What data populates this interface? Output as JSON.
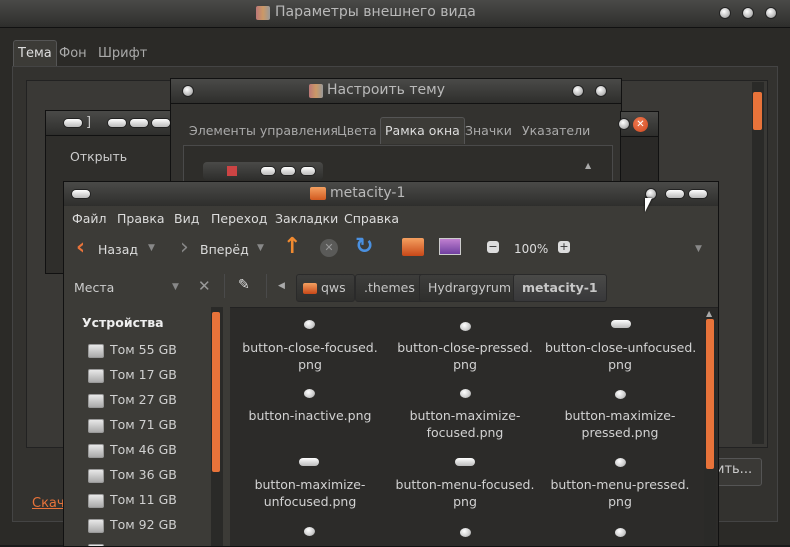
{
  "appearance_window": {
    "title": "Параметры внешнего вида",
    "tabs": [
      "Тема",
      "Фон",
      "Шрифт"
    ],
    "download_link": "Скача",
    "bottom_button": "ить..."
  },
  "mini_window": {
    "title": "]",
    "open_button": "Открыть"
  },
  "theme_window": {
    "title": "Настроить тему",
    "tabs": [
      "Элементы управления",
      "Цвета",
      "Рамка окна",
      "Значки",
      "Указатели"
    ]
  },
  "file_manager": {
    "title": "metacity-1",
    "menu": [
      "Файл",
      "Правка",
      "Вид",
      "Переход",
      "Закладки",
      "Справка"
    ],
    "toolbar": {
      "back": "Назад",
      "forward": "Вперёд",
      "zoom": "100%"
    },
    "places_label": "Места",
    "breadcrumbs": [
      "qws",
      ".themes",
      "Hydrargyrum",
      "metacity-1"
    ],
    "sidebar": {
      "header": "Устройства",
      "devices": [
        "Том 55 GB",
        "Том 17 GB",
        "Том 27 GB",
        "Том 71 GB",
        "Том 46 GB",
        "Том 36 GB",
        "Том 11 GB",
        "Том 92 GB"
      ]
    },
    "files": [
      {
        "name": "button-close-focused.\npng",
        "icon": "round"
      },
      {
        "name": "button-close-pressed.\npng",
        "icon": "round"
      },
      {
        "name": "button-close-unfocused.\npng",
        "icon": "wide"
      },
      {
        "name": "button-inactive.png",
        "icon": "round"
      },
      {
        "name": "button-maximize-\nfocused.png",
        "icon": "round"
      },
      {
        "name": "button-maximize-\npressed.png",
        "icon": "round"
      },
      {
        "name": "button-maximize-\nunfocused.png",
        "icon": "wide"
      },
      {
        "name": "button-menu-focused.\npng",
        "icon": "wide"
      },
      {
        "name": "button-menu-pressed.\npng",
        "icon": "round"
      }
    ],
    "accent_color": "#e8733a"
  }
}
